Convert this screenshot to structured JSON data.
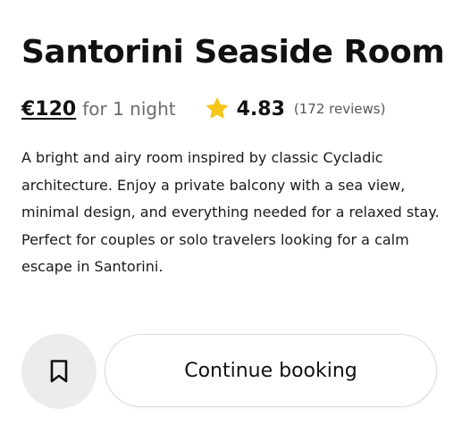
{
  "listing": {
    "title": "Santorini Seaside Room",
    "price": "€120",
    "price_period": "for 1 night",
    "rating_icon": "star-icon",
    "rating_color": "#F5C518",
    "rating_score": "4.83",
    "reviews": "(172 reviews)",
    "description": "A bright and airy room inspired by classic Cycladic architecture. Enjoy a private balcony with a sea view, minimal design, and everything needed for a relaxed stay. Perfect for couples or solo travelers looking for a calm escape in Santorini."
  },
  "actions": {
    "save_icon": "bookmark-icon",
    "continue_label": "Continue booking"
  }
}
